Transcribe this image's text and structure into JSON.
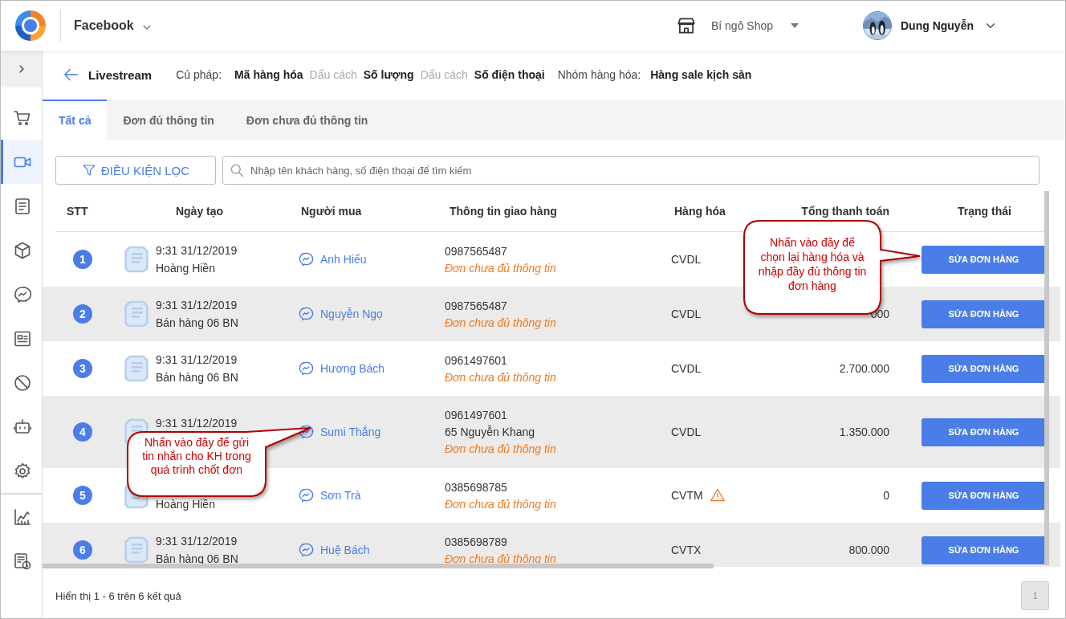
{
  "header": {
    "channel": "Facebook",
    "shop": "Bí ngô Shop",
    "user": "Dung Nguyễn"
  },
  "sidebar": {
    "items": [
      {
        "selected": false
      },
      {
        "selected": true
      },
      {
        "selected": false
      },
      {
        "selected": false
      },
      {
        "selected": false
      },
      {
        "selected": false
      },
      {
        "selected": false
      },
      {
        "selected": false
      },
      {
        "selected": false
      },
      {
        "selected": false
      },
      {
        "selected": false
      }
    ]
  },
  "toolbar": {
    "title": "Livestream",
    "syntax_label": "Cú pháp:",
    "syntax": [
      {
        "text": "Mã hàng hóa",
        "kind": "field"
      },
      {
        "text": "Dấu cách",
        "kind": "separator"
      },
      {
        "text": "Số lượng",
        "kind": "field"
      },
      {
        "text": "Dấu cách",
        "kind": "separator"
      },
      {
        "text": "Số điện thoại",
        "kind": "field"
      }
    ],
    "group_label": "Nhóm hàng hóa:",
    "group": "Hàng sale kịch sàn"
  },
  "tabs": [
    {
      "label": "Tất cả",
      "selected": true
    },
    {
      "label": "Đơn đủ thông tin",
      "selected": false
    },
    {
      "label": "Đơn chưa đủ thông tin",
      "selected": false
    }
  ],
  "filter_button": "ĐIỀU KIỆN LỌC",
  "search": {
    "placeholder": "Nhập tên khách hàng, số điện thoại để tìm kiếm"
  },
  "table": {
    "columns": [
      "STT",
      "Ngày tạo",
      "Người mua",
      "Thông tin giao hàng",
      "Hàng hóa",
      "Tổng thanh toán",
      "Trạng thái"
    ],
    "rows": [
      {
        "index": "1",
        "time": "9:31 31/12/2019",
        "source": "Hoàng Hiền",
        "buyer": "Anh Hiếu",
        "shipping": [
          "0987565487"
        ],
        "note": "Đơn chưa đủ thông tin",
        "goods": "CVDL",
        "warning": false,
        "action": "SỬA ĐƠN HÀNG"
      },
      {
        "index": "2",
        "time": "9:31 31/12/2019",
        "source": "Bán hàng 06 BN",
        "buyer": "Nguyễn Ngọ",
        "shipping": [
          "0987565487"
        ],
        "note": "Đơn chưa đủ thông tin",
        "goods": "CVDL",
        "warning": false,
        "total": "000",
        "action": "SỬA ĐƠN HÀNG"
      },
      {
        "index": "3",
        "time": "9:31 31/12/2019",
        "source": "Bán hàng 06 BN",
        "buyer": "Hương Bách",
        "shipping": [
          "0961497601"
        ],
        "note": "Đơn chưa đủ thông tin",
        "goods": "CVDL",
        "warning": false,
        "total": "2.700.000",
        "action": "SỬA ĐƠN HÀNG"
      },
      {
        "index": "4",
        "time": "9:31 31/12/2019",
        "buyer": "Sumi Thắng",
        "shipping": [
          "0961497601",
          "65 Nguyễn Khang"
        ],
        "note": "Đơn chưa đủ thông tin",
        "goods": "CVDL",
        "warning": false,
        "total": "1.350.000",
        "action": "SỬA ĐƠN HÀNG"
      },
      {
        "index": "5",
        "source": "Hoàng Hiền",
        "buyer": "Sơn Trà",
        "shipping": [
          "0385698785"
        ],
        "note": "Đơn chưa đủ thông tin",
        "goods": "CVTM",
        "warning": true,
        "total": "0",
        "action": "SỬA ĐƠN HÀNG"
      },
      {
        "index": "6",
        "time": "9:31 31/12/2019",
        "source": "Bán hàng 06 BN",
        "buyer": "Huệ Bách",
        "shipping": [
          "0385698789"
        ],
        "note": "Đơn chưa đủ thông tin",
        "goods": "CVTX",
        "warning": false,
        "total": "800.000",
        "action": "SỬA ĐƠN HÀNG"
      }
    ]
  },
  "footer": {
    "summary": "Hiển thị 1 - 6 trên 6 kết quả",
    "pages": [
      {
        "label": "1",
        "selected": true
      }
    ]
  },
  "callouts": [
    {
      "text": "Nhấn vào đây để chọn lại hàng hóa và nhập đầy đủ thông tin đơn hàng"
    },
    {
      "text": "Nhấn vào đây để gửi tin nhắn cho KH trong quá trình chốt đơn"
    }
  ]
}
